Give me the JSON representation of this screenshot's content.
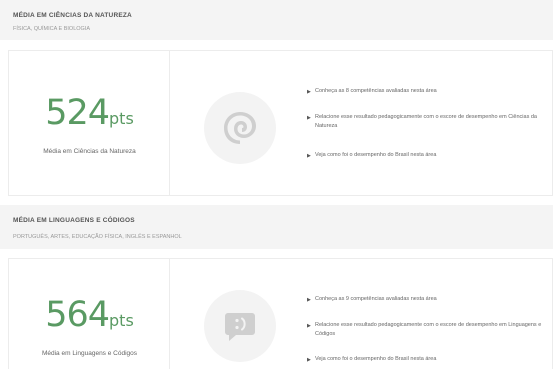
{
  "natureza": {
    "title": "MÉDIA EM CIÊNCIAS DA NATUREZA",
    "subtitle": "FÍSICA, QUÍMICA E BIOLOGIA",
    "score": "524",
    "unit": "pts",
    "score_label": "Média em Ciências da Natureza",
    "icon": "nautilus-shell-icon",
    "links": [
      "Conheça as 8 competências avaliadas nesta área",
      "Relacione esse resultado pedagogicamente com o escore de desempenho em Ciências da Natureza",
      "Veja como foi o desempenho do Brasil nesta área"
    ]
  },
  "linguagens": {
    "title": "MÉDIA EM LINGUAGENS E CÓDIGOS",
    "subtitle": "PORTUGUÊS, ARTES, EDUCAÇÃO FÍSICA, INGLÊS E ESPANHOL",
    "score": "564",
    "unit": "pts",
    "score_label": "Média em Linguagens e Códigos",
    "icon": "speech-bubble-icon",
    "links": [
      "Conheça as 9 competências avaliadas nesta área",
      "Relacione esse resultado pedagogicamente com o escore de desempenho em Linguagens e Códigos",
      "Veja como foi o desempenho do Brasil nesta área"
    ]
  },
  "colors": {
    "score_green": "#5a9a63",
    "header_bg": "#f4f4f4",
    "icon_bg": "#f3f3f3",
    "icon_fg": "#cfcfcf"
  }
}
